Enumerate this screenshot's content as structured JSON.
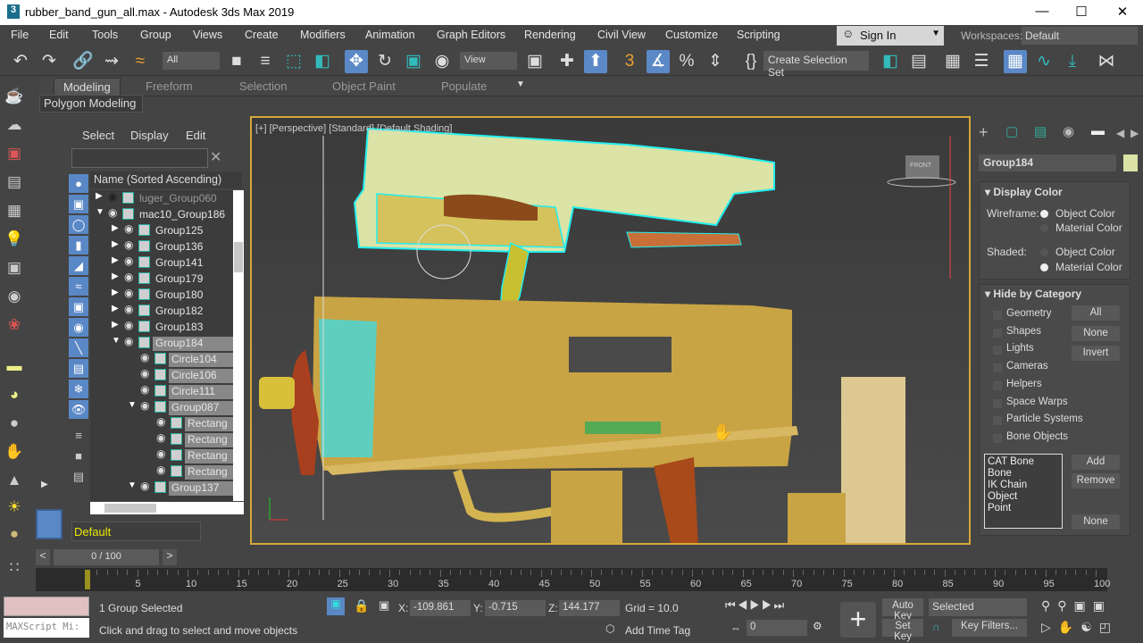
{
  "window": {
    "title": "rubber_band_gun_all.max - Autodesk 3ds Max 2019",
    "app_icon": "3"
  },
  "menu": [
    "File",
    "Edit",
    "Tools",
    "Group",
    "Views",
    "Create",
    "Modifiers",
    "Animation",
    "Graph Editors",
    "Rendering",
    "Civil View",
    "Customize",
    "Scripting"
  ],
  "account": {
    "sign_in": "Sign In",
    "workspaces_label": "Workspaces:",
    "workspace": "Default"
  },
  "toolbar": {
    "selection_filter": "All",
    "ref_coord": "View",
    "selection_set": "Create Selection Set"
  },
  "ribbon": {
    "tabs": [
      "Modeling",
      "Freeform",
      "Selection",
      "Object Paint",
      "Populate"
    ],
    "active": "Modeling",
    "panel": "Polygon Modeling"
  },
  "explorer": {
    "menus": [
      "Select",
      "Display",
      "Edit"
    ],
    "header": "Name (Sorted Ascending)",
    "rows": [
      {
        "name": "luger_Group060",
        "level": 0,
        "arrow": "right",
        "hidden": true
      },
      {
        "name": "mac10_Group186",
        "level": 0,
        "arrow": "down"
      },
      {
        "name": "Group125",
        "level": 1,
        "arrow": "right"
      },
      {
        "name": "Group136",
        "level": 1,
        "arrow": "right"
      },
      {
        "name": "Group141",
        "level": 1,
        "arrow": "right"
      },
      {
        "name": "Group179",
        "level": 1,
        "arrow": "right"
      },
      {
        "name": "Group180",
        "level": 1,
        "arrow": "right"
      },
      {
        "name": "Group182",
        "level": 1,
        "arrow": "right"
      },
      {
        "name": "Group183",
        "level": 1,
        "arrow": "right"
      },
      {
        "name": "Group184",
        "level": 1,
        "arrow": "down",
        "selected": true
      },
      {
        "name": "Circle104",
        "level": 2,
        "arrow": "",
        "selected": true
      },
      {
        "name": "Circle106",
        "level": 2,
        "arrow": "",
        "selected": true
      },
      {
        "name": "Circle111",
        "level": 2,
        "arrow": "",
        "selected": true
      },
      {
        "name": "Group087",
        "level": 2,
        "arrow": "down",
        "selected": true
      },
      {
        "name": "Rectang",
        "level": 3,
        "arrow": "",
        "selected": true
      },
      {
        "name": "Rectang",
        "level": 3,
        "arrow": "",
        "selected": true
      },
      {
        "name": "Rectang",
        "level": 3,
        "arrow": "",
        "selected": true
      },
      {
        "name": "Rectang",
        "level": 3,
        "arrow": "",
        "selected": true
      },
      {
        "name": "Group137",
        "level": 2,
        "arrow": "down",
        "selected": true
      }
    ],
    "layer": "Default"
  },
  "viewport": {
    "label": "[+] [Perspective] [Standard] [Default Shading]",
    "viewcube": "FRONT"
  },
  "command_panel": {
    "object_name": "Group184",
    "object_color": "#dbe3a6",
    "display_color": {
      "title": "Display Color",
      "wireframe_label": "Wireframe:",
      "shaded_label": "Shaded:",
      "opt1": "Object Color",
      "opt2": "Material Color",
      "wireframe": "Object Color",
      "shaded": "Material Color"
    },
    "hide_by_category": {
      "title": "Hide by Category",
      "categories": [
        "Geometry",
        "Shapes",
        "Lights",
        "Cameras",
        "Helpers",
        "Space Warps",
        "Particle Systems",
        "Bone Objects"
      ],
      "buttons": [
        "All",
        "None",
        "Invert"
      ],
      "list": [
        "CAT Bone",
        "Bone",
        "IK Chain Object",
        "Point"
      ],
      "list_buttons": [
        "Add",
        "Remove",
        "None"
      ]
    }
  },
  "timeline": {
    "frame": "0 / 100",
    "ticks": [
      0,
      5,
      10,
      15,
      20,
      25,
      30,
      35,
      40,
      45,
      50,
      55,
      60,
      65,
      70,
      75,
      80,
      85,
      90,
      95,
      100
    ]
  },
  "status": {
    "selection": "1 Group Selected",
    "prompt": "Click and drag to select and move objects",
    "maxscript": "MAXScript Mi:",
    "x": "-109.861",
    "y": "-0.715",
    "z": "144.177",
    "grid": "Grid = 10.0",
    "add_time_tag": "Add Time Tag",
    "current_frame": "0",
    "auto_key": "Auto Key",
    "set_key": "Set Key",
    "key_mode": "Selected",
    "key_filters": "Key Filters...",
    "x_label": "X:",
    "y_label": "Y:",
    "z_label": "Z:"
  }
}
